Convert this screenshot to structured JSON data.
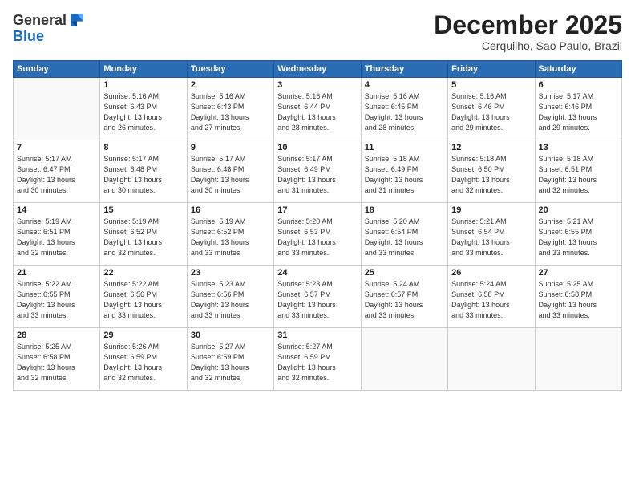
{
  "header": {
    "logo_general": "General",
    "logo_blue": "Blue",
    "month_title": "December 2025",
    "location": "Cerquilho, Sao Paulo, Brazil"
  },
  "weekdays": [
    "Sunday",
    "Monday",
    "Tuesday",
    "Wednesday",
    "Thursday",
    "Friday",
    "Saturday"
  ],
  "weeks": [
    [
      {
        "day": "",
        "info": ""
      },
      {
        "day": "1",
        "info": "Sunrise: 5:16 AM\nSunset: 6:43 PM\nDaylight: 13 hours\nand 26 minutes."
      },
      {
        "day": "2",
        "info": "Sunrise: 5:16 AM\nSunset: 6:43 PM\nDaylight: 13 hours\nand 27 minutes."
      },
      {
        "day": "3",
        "info": "Sunrise: 5:16 AM\nSunset: 6:44 PM\nDaylight: 13 hours\nand 28 minutes."
      },
      {
        "day": "4",
        "info": "Sunrise: 5:16 AM\nSunset: 6:45 PM\nDaylight: 13 hours\nand 28 minutes."
      },
      {
        "day": "5",
        "info": "Sunrise: 5:16 AM\nSunset: 6:46 PM\nDaylight: 13 hours\nand 29 minutes."
      },
      {
        "day": "6",
        "info": "Sunrise: 5:17 AM\nSunset: 6:46 PM\nDaylight: 13 hours\nand 29 minutes."
      }
    ],
    [
      {
        "day": "7",
        "info": "Sunrise: 5:17 AM\nSunset: 6:47 PM\nDaylight: 13 hours\nand 30 minutes."
      },
      {
        "day": "8",
        "info": "Sunrise: 5:17 AM\nSunset: 6:48 PM\nDaylight: 13 hours\nand 30 minutes."
      },
      {
        "day": "9",
        "info": "Sunrise: 5:17 AM\nSunset: 6:48 PM\nDaylight: 13 hours\nand 30 minutes."
      },
      {
        "day": "10",
        "info": "Sunrise: 5:17 AM\nSunset: 6:49 PM\nDaylight: 13 hours\nand 31 minutes."
      },
      {
        "day": "11",
        "info": "Sunrise: 5:18 AM\nSunset: 6:49 PM\nDaylight: 13 hours\nand 31 minutes."
      },
      {
        "day": "12",
        "info": "Sunrise: 5:18 AM\nSunset: 6:50 PM\nDaylight: 13 hours\nand 32 minutes."
      },
      {
        "day": "13",
        "info": "Sunrise: 5:18 AM\nSunset: 6:51 PM\nDaylight: 13 hours\nand 32 minutes."
      }
    ],
    [
      {
        "day": "14",
        "info": "Sunrise: 5:19 AM\nSunset: 6:51 PM\nDaylight: 13 hours\nand 32 minutes."
      },
      {
        "day": "15",
        "info": "Sunrise: 5:19 AM\nSunset: 6:52 PM\nDaylight: 13 hours\nand 32 minutes."
      },
      {
        "day": "16",
        "info": "Sunrise: 5:19 AM\nSunset: 6:52 PM\nDaylight: 13 hours\nand 33 minutes."
      },
      {
        "day": "17",
        "info": "Sunrise: 5:20 AM\nSunset: 6:53 PM\nDaylight: 13 hours\nand 33 minutes."
      },
      {
        "day": "18",
        "info": "Sunrise: 5:20 AM\nSunset: 6:54 PM\nDaylight: 13 hours\nand 33 minutes."
      },
      {
        "day": "19",
        "info": "Sunrise: 5:21 AM\nSunset: 6:54 PM\nDaylight: 13 hours\nand 33 minutes."
      },
      {
        "day": "20",
        "info": "Sunrise: 5:21 AM\nSunset: 6:55 PM\nDaylight: 13 hours\nand 33 minutes."
      }
    ],
    [
      {
        "day": "21",
        "info": "Sunrise: 5:22 AM\nSunset: 6:55 PM\nDaylight: 13 hours\nand 33 minutes."
      },
      {
        "day": "22",
        "info": "Sunrise: 5:22 AM\nSunset: 6:56 PM\nDaylight: 13 hours\nand 33 minutes."
      },
      {
        "day": "23",
        "info": "Sunrise: 5:23 AM\nSunset: 6:56 PM\nDaylight: 13 hours\nand 33 minutes."
      },
      {
        "day": "24",
        "info": "Sunrise: 5:23 AM\nSunset: 6:57 PM\nDaylight: 13 hours\nand 33 minutes."
      },
      {
        "day": "25",
        "info": "Sunrise: 5:24 AM\nSunset: 6:57 PM\nDaylight: 13 hours\nand 33 minutes."
      },
      {
        "day": "26",
        "info": "Sunrise: 5:24 AM\nSunset: 6:58 PM\nDaylight: 13 hours\nand 33 minutes."
      },
      {
        "day": "27",
        "info": "Sunrise: 5:25 AM\nSunset: 6:58 PM\nDaylight: 13 hours\nand 33 minutes."
      }
    ],
    [
      {
        "day": "28",
        "info": "Sunrise: 5:25 AM\nSunset: 6:58 PM\nDaylight: 13 hours\nand 32 minutes."
      },
      {
        "day": "29",
        "info": "Sunrise: 5:26 AM\nSunset: 6:59 PM\nDaylight: 13 hours\nand 32 minutes."
      },
      {
        "day": "30",
        "info": "Sunrise: 5:27 AM\nSunset: 6:59 PM\nDaylight: 13 hours\nand 32 minutes."
      },
      {
        "day": "31",
        "info": "Sunrise: 5:27 AM\nSunset: 6:59 PM\nDaylight: 13 hours\nand 32 minutes."
      },
      {
        "day": "",
        "info": ""
      },
      {
        "day": "",
        "info": ""
      },
      {
        "day": "",
        "info": ""
      }
    ]
  ]
}
